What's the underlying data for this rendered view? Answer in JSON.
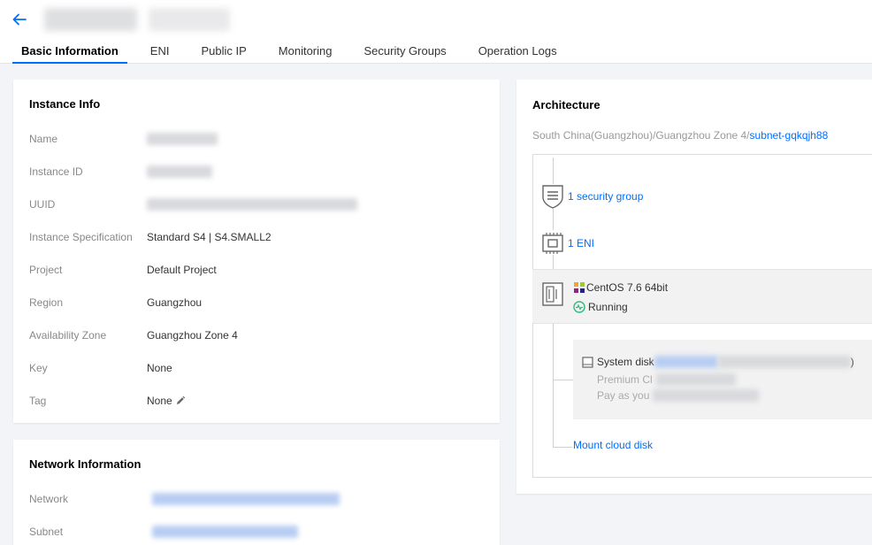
{
  "header": {
    "back_icon": "arrow-left-icon"
  },
  "tabs": [
    {
      "label": "Basic Information",
      "active": true
    },
    {
      "label": "ENI",
      "active": false
    },
    {
      "label": "Public IP",
      "active": false
    },
    {
      "label": "Monitoring",
      "active": false
    },
    {
      "label": "Security Groups",
      "active": false
    },
    {
      "label": "Operation Logs",
      "active": false
    }
  ],
  "instance_info": {
    "title": "Instance Info",
    "rows": [
      {
        "label": "Name",
        "value": ""
      },
      {
        "label": "Instance ID",
        "value": ""
      },
      {
        "label": "UUID",
        "value": ""
      },
      {
        "label": "Instance Specification",
        "value": "Standard S4 | S4.SMALL2"
      },
      {
        "label": "Project",
        "value": "Default Project"
      },
      {
        "label": "Region",
        "value": "Guangzhou"
      },
      {
        "label": "Availability Zone",
        "value": "Guangzhou Zone 4"
      },
      {
        "label": "Key",
        "value": "None"
      },
      {
        "label": "Tag",
        "value": "None"
      }
    ]
  },
  "network_info": {
    "title": "Network Information",
    "rows": [
      {
        "label": "Network",
        "value": ""
      },
      {
        "label": "Subnet",
        "value": ""
      }
    ]
  },
  "architecture": {
    "title": "Architecture",
    "path_prefix": "South China(Guangzhou)/Guangzhou Zone 4/",
    "subnet_link": "subnet-gqkqjh88",
    "security_group_link": "1 security group",
    "eni_link": "1 ENI",
    "os": "CentOS 7.6 64bit",
    "status": "Running",
    "disk_label": "System disk",
    "disk_close_paren": ")",
    "disk_type": "Premium Cl",
    "disk_billing": "Pay as you",
    "mount_link": "Mount cloud disk"
  },
  "colors": {
    "accent": "#006eff",
    "running": "#2fbb7d"
  }
}
